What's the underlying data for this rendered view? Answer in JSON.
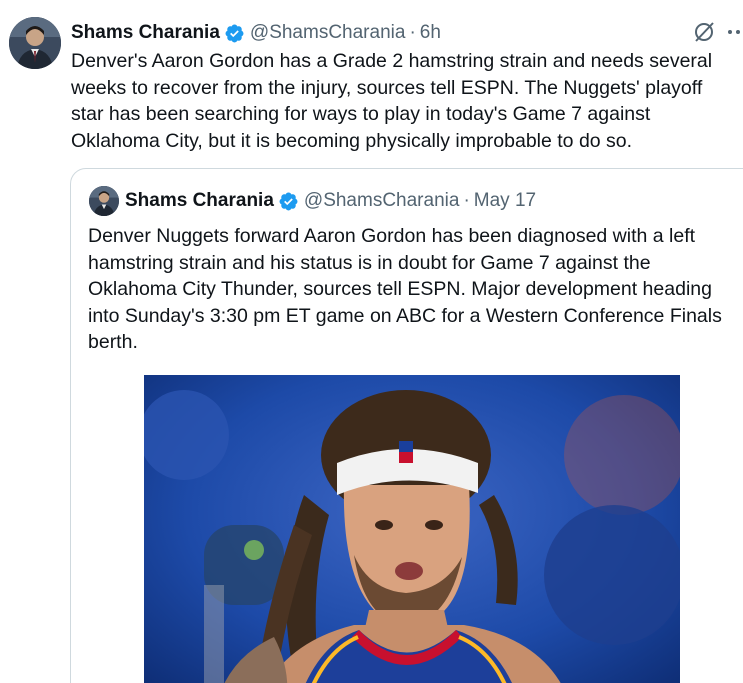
{
  "tweet": {
    "author_name": "Shams Charania",
    "handle": "@ShamsCharania",
    "separator": "·",
    "time": "6h",
    "text": "Denver's Aaron Gordon has a Grade 2 hamstring strain and needs several weeks to recover from the injury, sources tell ESPN. The Nuggets' playoff star has been searching for ways to play in today's Game 7 against Oklahoma City, but it is becoming physically improbable to do so."
  },
  "quote": {
    "author_name": "Shams Charania",
    "handle": "@ShamsCharania",
    "separator": "·",
    "time": "May 17",
    "text": "Denver Nuggets forward Aaron Gordon has been diagnosed with a left hamstring strain and his status is in doubt for Game 7 against the Oklahoma City Thunder, sources tell ESPN. Major development heading into Sunday's 3:30 pm ET game on ABC for a Western Conference Finals berth."
  },
  "icons": {
    "verified": "verified-badge-icon",
    "grok": "grok-icon",
    "more": "more-icon"
  },
  "colors": {
    "verified_blue": "#1d9bf0",
    "secondary_text": "#536471",
    "border": "#cfd9de"
  }
}
